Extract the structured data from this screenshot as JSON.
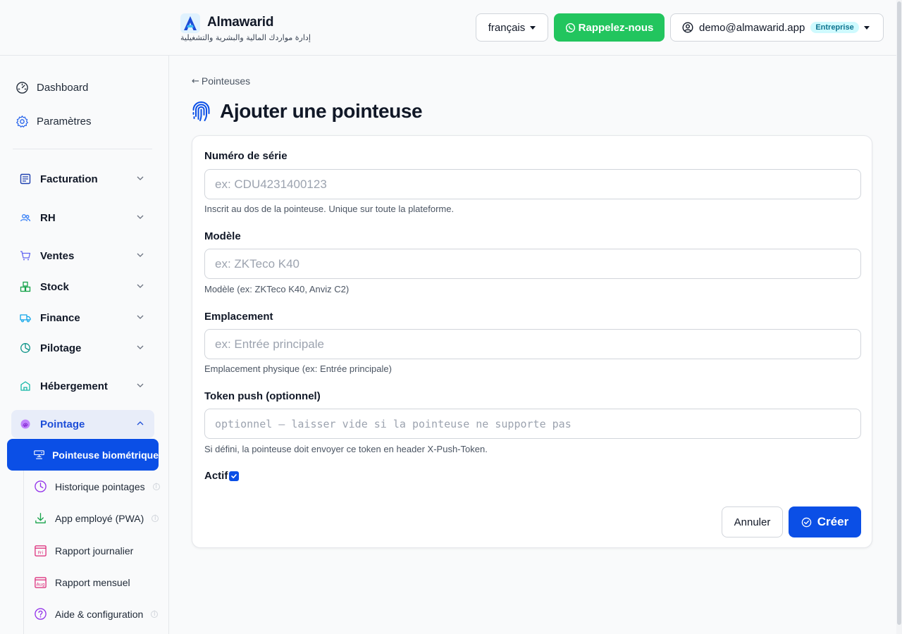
{
  "brand": {
    "name": "Almawarid",
    "subtitle": "إدارة مواردك المالية والبشرية والتشغيلية"
  },
  "header": {
    "language": "français",
    "callback_label": "Rappelez-nous",
    "user_email": "demo@almawarid.app",
    "plan_badge": "Entreprise"
  },
  "sidebar": {
    "links": [
      {
        "label": "Dashboard",
        "icon": "gauge-icon"
      },
      {
        "label": "Paramètres",
        "icon": "gear-icon"
      }
    ],
    "groups": [
      {
        "label": "Facturation",
        "icon": "invoice-icon"
      },
      {
        "label": "RH",
        "icon": "users-icon"
      },
      {
        "label": "Ventes",
        "icon": "cart-icon"
      },
      {
        "label": "Stock",
        "icon": "boxes-icon"
      },
      {
        "label": "Finance",
        "icon": "truck-icon"
      },
      {
        "label": "Pilotage",
        "icon": "pie-chart-icon"
      },
      {
        "label": "Hébergement",
        "icon": "building-icon"
      },
      {
        "label": "Pointage",
        "icon": "fingerprint-icon"
      }
    ],
    "pointage_items": [
      {
        "label": "Pointeuse biométrique",
        "icon": "device-icon"
      },
      {
        "label": "Historique pointages",
        "icon": "clock-icon"
      },
      {
        "label": "App employé (PWA)",
        "icon": "download-icon"
      },
      {
        "label": "Rapport journalier",
        "icon": "calendar-day-icon",
        "icon_text": "Fri"
      },
      {
        "label": "Rapport mensuel",
        "icon": "calendar-month-icon",
        "icon_text": "Aug"
      },
      {
        "label": "Aide & configuration",
        "icon": "help-icon"
      }
    ]
  },
  "page": {
    "breadcrumb": "Pointeuses",
    "title": "Ajouter une pointeuse"
  },
  "form": {
    "serial": {
      "label": "Numéro de série",
      "placeholder": "ex: CDU4231400123",
      "help": "Inscrit au dos de la pointeuse. Unique sur toute la plateforme."
    },
    "model": {
      "label": "Modèle",
      "placeholder": "ex: ZKTeco K40",
      "help": "Modèle (ex: ZKTeco K40, Anviz C2)"
    },
    "location": {
      "label": "Emplacement",
      "placeholder": "ex: Entrée principale",
      "help": "Emplacement physique (ex: Entrée principale)"
    },
    "token": {
      "label": "Token push (optionnel)",
      "placeholder": "optionnel — laisser vide si la pointeuse ne supporte pas",
      "help": "Si défini, la pointeuse doit envoyer ce token en header X-Push-Token."
    },
    "active": {
      "label": "Actif",
      "checked": true
    },
    "cancel_label": "Annuler",
    "submit_label": "Créer"
  },
  "colors": {
    "primary": "#0b4fe6",
    "whatsapp": "#22c55e",
    "badge_bg": "#cffafe"
  }
}
